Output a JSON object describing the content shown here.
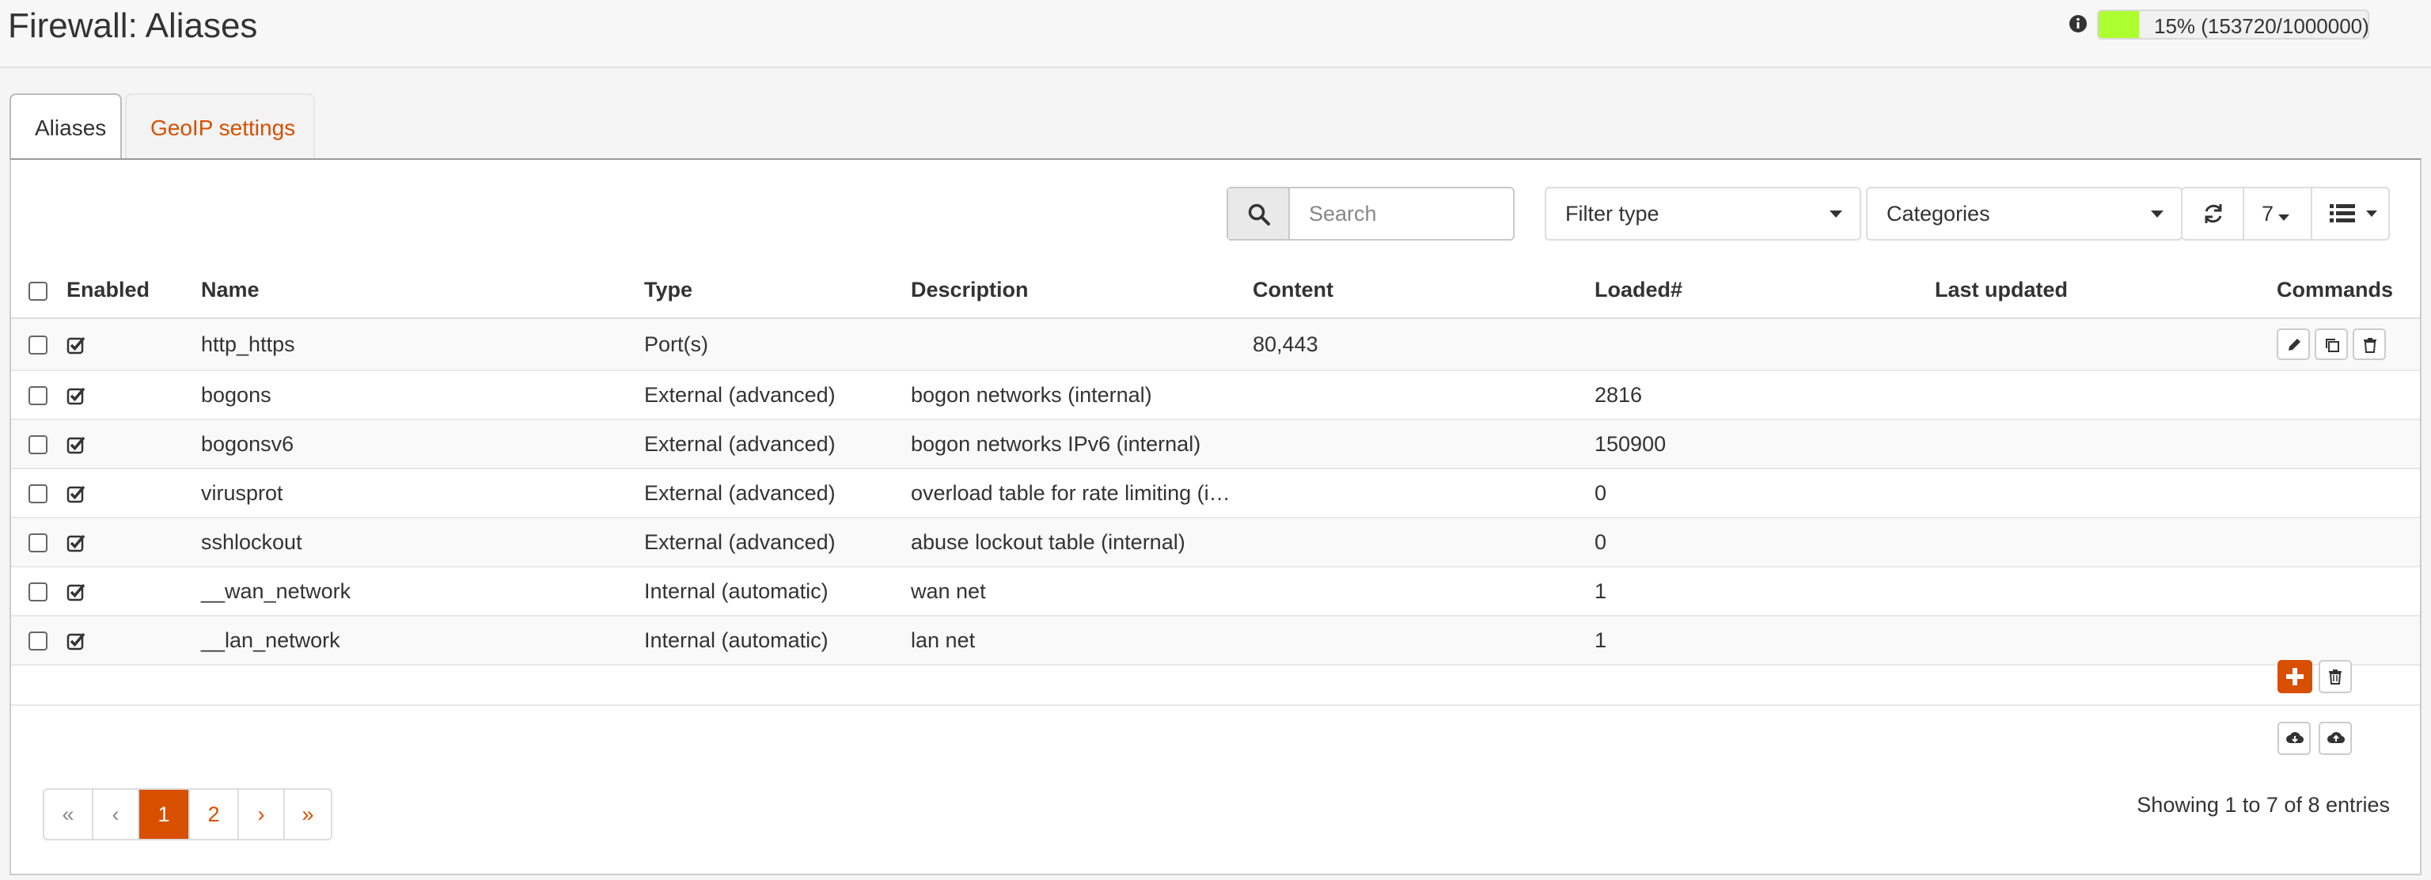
{
  "header": {
    "title": "Firewall: Aliases",
    "usage": {
      "label": "15% (153720/1000000)",
      "percent": 15,
      "color": "#adff2f"
    }
  },
  "tabs": [
    {
      "label": "Aliases",
      "active": true
    },
    {
      "label": "GeoIP settings",
      "active": false
    }
  ],
  "toolbar": {
    "search_placeholder": "Search",
    "filter_type": "Filter type",
    "categories": "Categories",
    "page_size": "7"
  },
  "table": {
    "columns": [
      "Enabled",
      "Name",
      "Type",
      "Description",
      "Content",
      "Loaded#",
      "Last updated",
      "Commands"
    ],
    "rows": [
      {
        "name": "http_https",
        "type": "Port(s)",
        "description": "",
        "content": "80,443",
        "loaded": "",
        "last_updated": ""
      },
      {
        "name": "bogons",
        "type": "External (advanced)",
        "description": "bogon networks (internal)",
        "content": "",
        "loaded": "2816",
        "last_updated": ""
      },
      {
        "name": "bogonsv6",
        "type": "External (advanced)",
        "description": "bogon networks IPv6 (internal)",
        "content": "",
        "loaded": "150900",
        "last_updated": ""
      },
      {
        "name": "virusprot",
        "type": "External (advanced)",
        "description": "overload table for rate limiting (i…",
        "content": "",
        "loaded": "0",
        "last_updated": ""
      },
      {
        "name": "sshlockout",
        "type": "External (advanced)",
        "description": "abuse lockout table (internal)",
        "content": "",
        "loaded": "0",
        "last_updated": ""
      },
      {
        "name": "__wan_network",
        "type": "Internal (automatic)",
        "description": "wan net",
        "content": "",
        "loaded": "1",
        "last_updated": ""
      },
      {
        "name": "__lan_network",
        "type": "Internal (automatic)",
        "description": "lan net",
        "content": "",
        "loaded": "1",
        "last_updated": ""
      }
    ]
  },
  "pagination": {
    "pages": [
      "«",
      "‹",
      "1",
      "2",
      "›",
      "»"
    ],
    "current": "1",
    "summary": "Showing 1 to 7 of 8 entries"
  },
  "colors": {
    "accent": "#d94f00",
    "usage_fill": "#adff2f"
  }
}
